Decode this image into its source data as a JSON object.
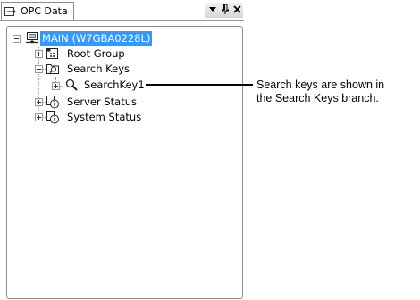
{
  "panel": {
    "tab_label": "OPC Data",
    "buttons": [
      "dropdown-icon",
      "pin-icon",
      "close-icon"
    ]
  },
  "tree": {
    "root": {
      "label": "MAIN (W7GBA0228L)",
      "expanded": true,
      "selected": true
    },
    "items": [
      {
        "label": "Root Group",
        "expanded": false,
        "icon": "group-icon"
      },
      {
        "label": "Search Keys",
        "expanded": true,
        "icon": "search-folder-icon"
      },
      {
        "label": "SearchKey1",
        "expanded": false,
        "icon": "magnifier-icon"
      },
      {
        "label": "Server Status",
        "expanded": false,
        "icon": "status-info-icon"
      },
      {
        "label": "System Status",
        "expanded": false,
        "icon": "status-info-icon"
      }
    ]
  },
  "callout": {
    "line1": "Search keys are shown in",
    "line2": "the Search Keys branch."
  }
}
